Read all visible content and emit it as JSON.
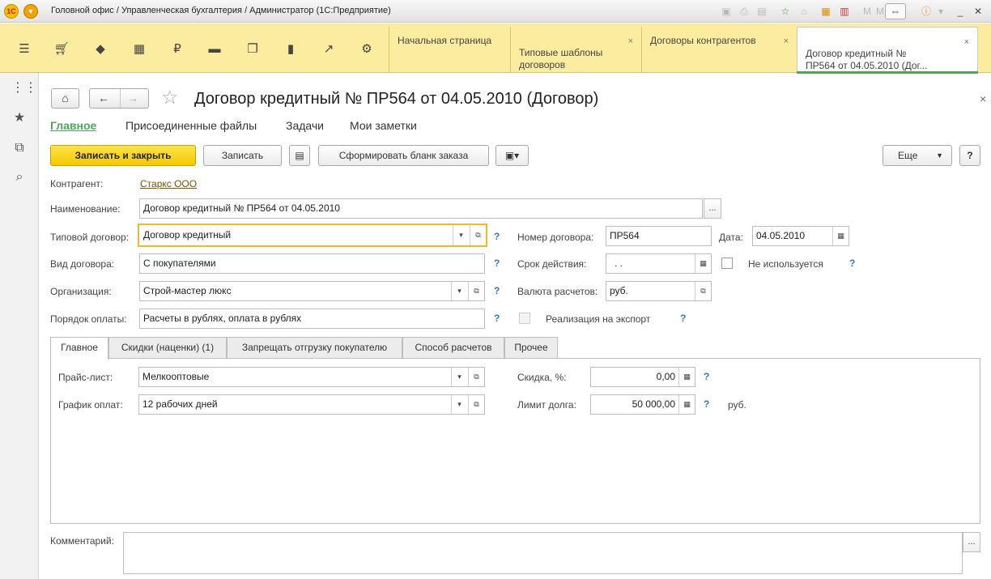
{
  "window": {
    "logo_text": "1С",
    "title": "Головной офис / Управленческая бухгалтерия / Администратор  (1С:Предприятие)"
  },
  "tabs": [
    {
      "label": "Начальная страница"
    },
    {
      "label": "Типовые шаблоны\nдоговоров"
    },
    {
      "label": "Договоры контрагентов"
    },
    {
      "label": "Договор кредитный №\nПР564 от 04.05.2010 (Дог..."
    }
  ],
  "tab_close": "×",
  "form": {
    "title": "Договор кредитный № ПР564 от 04.05.2010 (Договор)",
    "subtabs": [
      {
        "label": "Главное"
      },
      {
        "label": "Присоединенные файлы"
      },
      {
        "label": "Задачи"
      },
      {
        "label": "Мои заметки"
      }
    ]
  },
  "toolbar": {
    "save_close": "Записать и закрыть",
    "save": "Записать",
    "print_form": "Сформировать бланк заказа",
    "more": "Еще",
    "help": "?"
  },
  "fields": {
    "counterparty_label": "Контрагент:",
    "counterparty_value": "Старкс ООО",
    "name_label": "Наименование:",
    "name_value": "Договор кредитный № ПР564 от 04.05.2010",
    "template_label": "Типовой договор:",
    "template_value": "Договор кредитный",
    "contract_number_label": "Номер договора:",
    "contract_number_value": "ПР564",
    "date_label": "Дата:",
    "date_value": "04.05.2010",
    "kind_label": "Вид договора:",
    "kind_value": "С покупателями",
    "validity_label": "Срок действия:",
    "validity_value": " .  .",
    "not_used_label": "Не используется",
    "org_label": "Организация:",
    "org_value": "Строй-мастер люкс",
    "currency_label": "Валюта расчетов:",
    "currency_value": "руб.",
    "payment_label": "Порядок оплаты:",
    "payment_value": "Расчеты в рублях, оплата в рублях",
    "export_label": "Реализация на экспорт",
    "q": "?"
  },
  "inner_tabs": [
    {
      "label": "Главное"
    },
    {
      "label": "Скидки (наценки) (1)"
    },
    {
      "label": "Запрещать отгрузку покупателю"
    },
    {
      "label": "Способ расчетов"
    },
    {
      "label": "Прочее"
    }
  ],
  "inner": {
    "price_label": "Прайс-лист:",
    "price_value": "Мелкооптовые",
    "discount_label": "Скидка, %:",
    "discount_value": "0,00",
    "schedule_label": "График оплат:",
    "schedule_value": "12 рабочих дней",
    "debt_limit_label": "Лимит долга:",
    "debt_limit_value": "50 000,00",
    "debt_currency": "руб."
  },
  "comment_label": "Комментарий:"
}
